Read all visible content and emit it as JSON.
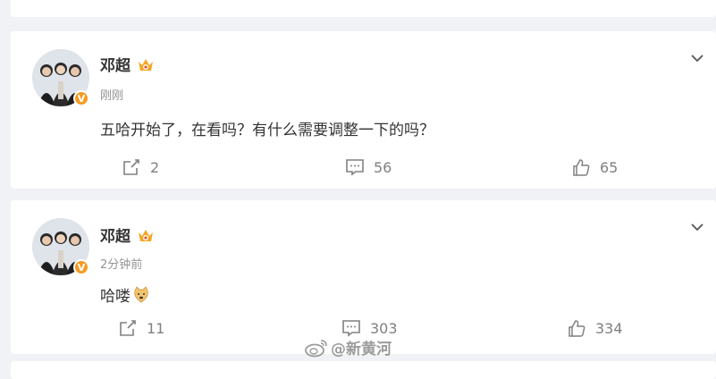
{
  "posts": [
    {
      "author": "邓超",
      "time": "刚刚",
      "text": "五哈开始了，在看吗？有什么需要调整一下的吗？",
      "reposts": "2",
      "comments": "56",
      "likes": "65"
    },
    {
      "author": "邓超",
      "time": "2分钟前",
      "text": "哈喽",
      "reposts": "11",
      "comments": "303",
      "likes": "334"
    }
  ],
  "watermark": "@新黄河",
  "verified_badge": "V",
  "colors": {
    "background": "#f1f2f5",
    "card": "#ffffff",
    "verified": "#f59b22",
    "text": "#333333",
    "muted": "#939393"
  }
}
